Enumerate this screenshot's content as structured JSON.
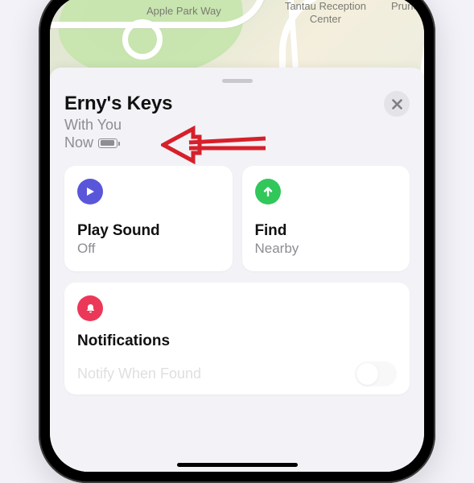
{
  "map": {
    "label_park": "Apple Park Way",
    "label_center": "Tantau Reception\nCenter",
    "label_right": "Pruner"
  },
  "sheet": {
    "title": "Erny's Keys",
    "status_line1": "With You",
    "status_line2": "Now",
    "close_name": "close"
  },
  "actions": {
    "play": {
      "label": "Play Sound",
      "state": "Off"
    },
    "find": {
      "label": "Find",
      "state": "Nearby"
    }
  },
  "notifications": {
    "heading": "Notifications",
    "row1_label": "Notify When Found"
  }
}
